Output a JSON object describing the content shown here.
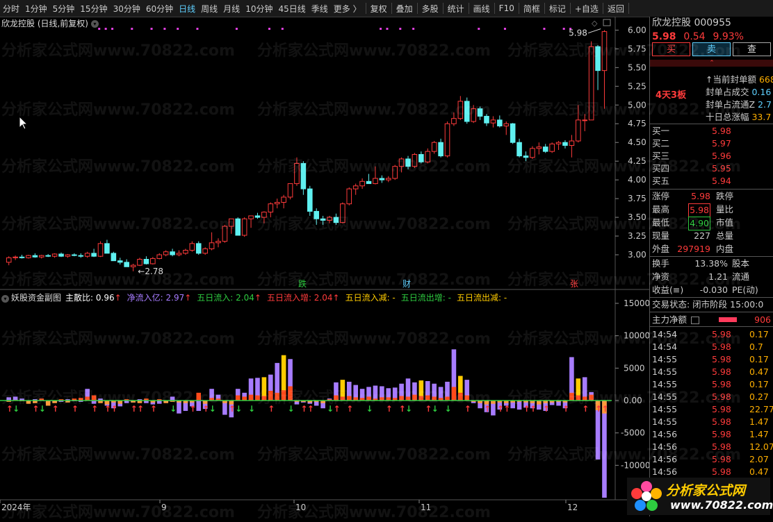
{
  "toolbar": {
    "items": [
      "分时",
      "1分钟",
      "5分钟",
      "15分钟",
      "30分钟",
      "60分钟",
      "日线",
      "周线",
      "月线",
      "10分钟",
      "45日线",
      "季线",
      "更多 〉",
      "复权",
      "叠加",
      "多股",
      "统计",
      "画线",
      "F10",
      "简框",
      "标记",
      "+自选",
      "返回"
    ],
    "active": "日线"
  },
  "main_chart": {
    "title": "欣龙控股 (日线,前复权)",
    "y_ticks": [
      "6.00",
      "5.75",
      "5.50",
      "5.25",
      "5.00",
      "4.75",
      "4.50",
      "4.25",
      "4.00",
      "3.75",
      "3.50",
      "3.25",
      "3.00"
    ],
    "high_label": "5.98",
    "low_label": "2.78",
    "markers": [
      "跌",
      "财",
      "张"
    ]
  },
  "indicator": {
    "title": "妖股资金副图",
    "fields": [
      {
        "label": "主散比:",
        "value": "0.96",
        "arrow": "↑",
        "color": "#ffffff"
      },
      {
        "label": "净流入亿:",
        "value": "2.97",
        "arrow": "↑",
        "color": "#a77cff"
      },
      {
        "label": "五日流入:",
        "value": "2.04",
        "arrow": "↑",
        "color": "#2ecc40"
      },
      {
        "label": "五日流入增:",
        "value": "2.04",
        "arrow": "↑",
        "color": "#ff3b3b"
      },
      {
        "label": "五日流入减:",
        "value": "-",
        "arrow": "",
        "color": "#ffcc00"
      },
      {
        "label": "五日流出增:",
        "value": "-",
        "arrow": "",
        "color": "#2ecc40"
      },
      {
        "label": "五日流出减:",
        "value": "-",
        "arrow": "",
        "color": "#ffcc00"
      }
    ],
    "y_ticks": [
      "15000",
      "10000",
      "5000",
      "0.00",
      "-5000",
      "-10000"
    ]
  },
  "x_axis": [
    "2024年",
    "9",
    "10",
    "11",
    "12"
  ],
  "chart_data": {
    "type": "candlestick",
    "ylim": [
      2.75,
      6.05
    ],
    "ohlc": [
      [
        2.9,
        2.98,
        2.86,
        2.96
      ],
      [
        2.96,
        2.99,
        2.93,
        2.97
      ],
      [
        2.97,
        3.0,
        2.95,
        2.96
      ],
      [
        2.96,
        3.0,
        2.95,
        2.99
      ],
      [
        2.99,
        3.02,
        2.96,
        2.97
      ],
      [
        2.97,
        3.0,
        2.95,
        2.99
      ],
      [
        2.99,
        3.01,
        2.97,
        2.98
      ],
      [
        2.98,
        3.02,
        2.96,
        3.01
      ],
      [
        3.01,
        3.03,
        2.97,
        2.98
      ],
      [
        2.98,
        3.01,
        2.96,
        3.0
      ],
      [
        3.0,
        3.02,
        2.98,
        2.99
      ],
      [
        2.99,
        3.02,
        2.96,
        2.98
      ],
      [
        2.98,
        3.04,
        2.96,
        3.02
      ],
      [
        3.02,
        3.08,
        2.97,
        2.98
      ],
      [
        2.98,
        3.18,
        2.97,
        3.15
      ],
      [
        3.15,
        3.2,
        3.05,
        3.02
      ],
      [
        3.02,
        3.04,
        2.92,
        2.92
      ],
      [
        2.92,
        2.96,
        2.87,
        2.9
      ],
      [
        2.9,
        2.94,
        2.84,
        2.84
      ],
      [
        2.84,
        2.88,
        2.78,
        2.86
      ],
      [
        2.86,
        2.96,
        2.85,
        2.94
      ],
      [
        2.94,
        2.98,
        2.87,
        2.88
      ],
      [
        2.88,
        2.97,
        2.87,
        2.95
      ],
      [
        2.95,
        3.02,
        2.94,
        3.0
      ],
      [
        3.0,
        3.06,
        2.98,
        3.04
      ],
      [
        3.04,
        3.08,
        2.98,
        3.0
      ],
      [
        3.0,
        3.06,
        2.98,
        3.02
      ],
      [
        3.02,
        3.08,
        3.0,
        3.06
      ],
      [
        3.06,
        3.18,
        3.04,
        3.15
      ],
      [
        3.15,
        3.18,
        3.0,
        3.02
      ],
      [
        3.02,
        3.1,
        3.0,
        3.08
      ],
      [
        3.08,
        3.3,
        3.06,
        3.16
      ],
      [
        3.16,
        3.22,
        3.1,
        3.18
      ],
      [
        3.18,
        3.4,
        3.16,
        3.38
      ],
      [
        3.38,
        3.48,
        3.28,
        3.48
      ],
      [
        3.48,
        3.5,
        3.3,
        3.26
      ],
      [
        3.26,
        3.5,
        3.24,
        3.48
      ],
      [
        3.48,
        3.52,
        3.36,
        3.52
      ],
      [
        3.52,
        3.56,
        3.48,
        3.5
      ],
      [
        3.5,
        3.58,
        3.42,
        3.57
      ],
      [
        3.57,
        3.7,
        3.5,
        3.68
      ],
      [
        3.68,
        3.75,
        3.62,
        3.7
      ],
      [
        3.7,
        3.8,
        3.62,
        3.77
      ],
      [
        3.77,
        3.95,
        3.74,
        3.95
      ],
      [
        3.95,
        4.3,
        3.92,
        4.22
      ],
      [
        4.22,
        4.25,
        3.8,
        3.88
      ],
      [
        3.88,
        3.92,
        3.52,
        3.58
      ],
      [
        3.58,
        3.62,
        3.4,
        3.48
      ],
      [
        3.48,
        3.52,
        3.4,
        3.46
      ],
      [
        3.46,
        3.52,
        3.42,
        3.5
      ],
      [
        3.5,
        3.55,
        3.4,
        3.43
      ],
      [
        3.43,
        3.7,
        3.42,
        3.68
      ],
      [
        3.68,
        3.9,
        3.66,
        3.88
      ],
      [
        3.88,
        3.95,
        3.8,
        3.92
      ],
      [
        3.92,
        4.02,
        3.88,
        3.98
      ],
      [
        3.98,
        4.08,
        3.95,
        3.95
      ],
      [
        3.95,
        4.18,
        3.94,
        4.02
      ],
      [
        4.02,
        4.06,
        3.96,
        4.0
      ],
      [
        4.0,
        4.05,
        3.97,
        4.02
      ],
      [
        4.02,
        4.2,
        4.0,
        4.18
      ],
      [
        4.18,
        4.3,
        4.1,
        4.28
      ],
      [
        4.28,
        4.32,
        4.14,
        4.18
      ],
      [
        4.18,
        4.36,
        4.16,
        4.34
      ],
      [
        4.34,
        4.38,
        4.22,
        4.24
      ],
      [
        4.24,
        4.42,
        4.22,
        4.38
      ],
      [
        4.38,
        4.52,
        4.35,
        4.5
      ],
      [
        4.5,
        4.55,
        4.3,
        4.32
      ],
      [
        4.32,
        4.78,
        4.3,
        4.75
      ],
      [
        4.75,
        4.9,
        4.72,
        4.82
      ],
      [
        4.82,
        5.12,
        4.8,
        5.05
      ],
      [
        5.05,
        5.1,
        4.75,
        4.78
      ],
      [
        4.78,
        5.0,
        4.76,
        4.95
      ],
      [
        4.95,
        4.98,
        4.8,
        4.85
      ],
      [
        4.85,
        4.88,
        4.72,
        4.76
      ],
      [
        4.76,
        4.85,
        4.7,
        4.8
      ],
      [
        4.8,
        4.86,
        4.7,
        4.72
      ],
      [
        4.72,
        4.78,
        4.6,
        4.75
      ],
      [
        4.75,
        4.76,
        4.48,
        4.5
      ],
      [
        4.5,
        4.55,
        4.3,
        4.32
      ],
      [
        4.32,
        4.38,
        4.25,
        4.3
      ],
      [
        4.3,
        4.45,
        4.28,
        4.42
      ],
      [
        4.42,
        4.5,
        4.34,
        4.44
      ],
      [
        4.44,
        4.48,
        4.36,
        4.38
      ],
      [
        4.38,
        4.5,
        4.36,
        4.48
      ],
      [
        4.48,
        4.52,
        4.4,
        4.5
      ],
      [
        4.5,
        4.53,
        4.42,
        4.46
      ],
      [
        4.46,
        4.6,
        4.3,
        4.52
      ],
      [
        4.52,
        5.0,
        4.5,
        4.8
      ],
      [
        4.8,
        4.88,
        4.65,
        4.8
      ],
      [
        4.8,
        5.85,
        4.8,
        5.78
      ],
      [
        5.78,
        5.8,
        5.2,
        5.46
      ],
      [
        5.46,
        6.0,
        4.95,
        5.98
      ]
    ],
    "flows": [
      [
        500,
        -200
      ],
      [
        600,
        100
      ],
      [
        300,
        -100
      ],
      [
        -200,
        -500
      ],
      [
        200,
        -400
      ],
      [
        100,
        300
      ],
      [
        -100,
        -800
      ],
      [
        -300,
        -400
      ],
      [
        -200,
        200
      ],
      [
        200,
        -300
      ],
      [
        -100,
        300
      ],
      [
        -200,
        400
      ],
      [
        1800,
        600
      ],
      [
        -500,
        800
      ],
      [
        300,
        -400
      ],
      [
        -800,
        -600
      ],
      [
        -1200,
        -300
      ],
      [
        -900,
        -500
      ],
      [
        -400,
        200
      ],
      [
        -300,
        -300
      ],
      [
        200,
        -400
      ],
      [
        -400,
        300
      ],
      [
        -600,
        -300
      ],
      [
        -500,
        200
      ],
      [
        -300,
        -400
      ],
      [
        600,
        -200
      ],
      [
        -2000,
        -300
      ],
      [
        -1600,
        -400
      ],
      [
        -900,
        -300
      ],
      [
        -1600,
        1200
      ],
      [
        -1300,
        -500
      ],
      [
        1800,
        400
      ],
      [
        900,
        300
      ],
      [
        -2200,
        -400
      ],
      [
        -2600,
        -600
      ],
      [
        1800,
        800
      ],
      [
        1200,
        600
      ],
      [
        3400,
        900
      ],
      [
        3500,
        800
      ],
      [
        3600,
        700
      ],
      [
        4000,
        1500
      ],
      [
        5800,
        1200
      ],
      [
        7000,
        1600
      ],
      [
        6400,
        2200
      ],
      [
        -600,
        -200
      ],
      [
        -300,
        -200
      ],
      [
        -500,
        -300
      ],
      [
        -800,
        -200
      ],
      [
        -1200,
        -400
      ],
      [
        300,
        200
      ],
      [
        2800,
        800
      ],
      [
        3200,
        600
      ],
      [
        2900,
        700
      ],
      [
        2400,
        500
      ],
      [
        1800,
        400
      ],
      [
        2100,
        600
      ],
      [
        2300,
        300
      ],
      [
        2200,
        500
      ],
      [
        1900,
        500
      ],
      [
        2000,
        400
      ],
      [
        2600,
        700
      ],
      [
        3400,
        600
      ],
      [
        2800,
        900
      ],
      [
        3100,
        700
      ],
      [
        3000,
        800
      ],
      [
        2600,
        600
      ],
      [
        2100,
        400
      ],
      [
        2900,
        600
      ],
      [
        7900,
        2100
      ],
      [
        3800,
        1200
      ],
      [
        3200,
        800
      ],
      [
        -400,
        -200
      ],
      [
        -1200,
        -400
      ],
      [
        -1800,
        -600
      ],
      [
        -2300,
        -500
      ],
      [
        -1400,
        -300
      ],
      [
        -800,
        -400
      ],
      [
        -1200,
        -300
      ],
      [
        -1400,
        -200
      ],
      [
        -1100,
        -300
      ],
      [
        -1200,
        -400
      ],
      [
        -1400,
        -600
      ],
      [
        -1600,
        -400
      ],
      [
        -700,
        -300
      ],
      [
        -800,
        -200
      ],
      [
        -1200,
        -300
      ],
      [
        6700,
        1200
      ],
      [
        3400,
        800
      ],
      [
        3600,
        600
      ],
      [
        1300,
        900
      ],
      [
        -9100,
        -1500
      ],
      [
        -15000,
        -2000
      ]
    ]
  },
  "right_panel": {
    "name": "欣龙控股",
    "code": "000955",
    "price": "5.98",
    "change": "0.54",
    "pct": "9.93%",
    "buy_label": "买",
    "sell_label": "卖",
    "query_label": "查",
    "board_tag": "4天3板",
    "seal_rows": [
      {
        "label": "↑当前封单额",
        "value": "668"
      },
      {
        "label": "封单占成交",
        "value": "0.16"
      },
      {
        "label": "封单占流通Z",
        "value": "2.7"
      },
      {
        "label": "十日总涨幅",
        "value": "33.7"
      }
    ],
    "bids": [
      {
        "label": "买一",
        "price": "5.98"
      },
      {
        "label": "买二",
        "price": "5.97"
      },
      {
        "label": "买三",
        "price": "5.96"
      },
      {
        "label": "买四",
        "price": "5.95"
      },
      {
        "label": "买五",
        "price": "5.94"
      }
    ],
    "stats": [
      {
        "l1": "涨停",
        "v1": "5.98",
        "l2": "跌停",
        "c1": "red"
      },
      {
        "l1": "最高",
        "v1": "5.98",
        "l2": "量比",
        "c1": "red",
        "box": "red"
      },
      {
        "l1": "最低",
        "v1": "4.90",
        "l2": "市值",
        "c1": "green",
        "box": "green"
      },
      {
        "l1": "现量",
        "v1": "227",
        "l2": "总量",
        "c1": "gray"
      },
      {
        "l1": "外盘",
        "v1": "297919",
        "l2": "内盘",
        "c1": "red"
      }
    ],
    "stats2": [
      {
        "l1": "换手",
        "v1": "13.38%",
        "l2": "股本"
      },
      {
        "l1": "净资",
        "v1": "1.21",
        "l2": "流通"
      },
      {
        "l1": "收益(≡)",
        "v1": "-0.030",
        "l2": "PE(动)"
      }
    ],
    "trade_status": "交易状态: 闭市阶段 15:00:0",
    "main_net_label": "主力净额",
    "main_net_value": "906",
    "ticks": [
      {
        "t": "14:54",
        "p": "5.98",
        "v": "0.17"
      },
      {
        "t": "14:54",
        "p": "5.98",
        "v": "0.7"
      },
      {
        "t": "14:55",
        "p": "5.98",
        "v": "0.17"
      },
      {
        "t": "14:55",
        "p": "5.98",
        "v": "0.47"
      },
      {
        "t": "14:55",
        "p": "5.98",
        "v": "0.17"
      },
      {
        "t": "14:55",
        "p": "5.98",
        "v": "0.27"
      },
      {
        "t": "14:55",
        "p": "5.98",
        "v": "22.77"
      },
      {
        "t": "14:55",
        "p": "5.98",
        "v": "1.47"
      },
      {
        "t": "14:56",
        "p": "5.98",
        "v": "1.47"
      },
      {
        "t": "14:56",
        "p": "5.98",
        "v": "12.07"
      },
      {
        "t": "14:56",
        "p": "5.98",
        "v": "2.07"
      },
      {
        "t": "14:56",
        "p": "5.98",
        "v": "0.47"
      }
    ]
  },
  "watermark": "分析家公式网www.70822.com",
  "logo": {
    "text": "分析家公式网",
    "url": "www.70822.com"
  }
}
